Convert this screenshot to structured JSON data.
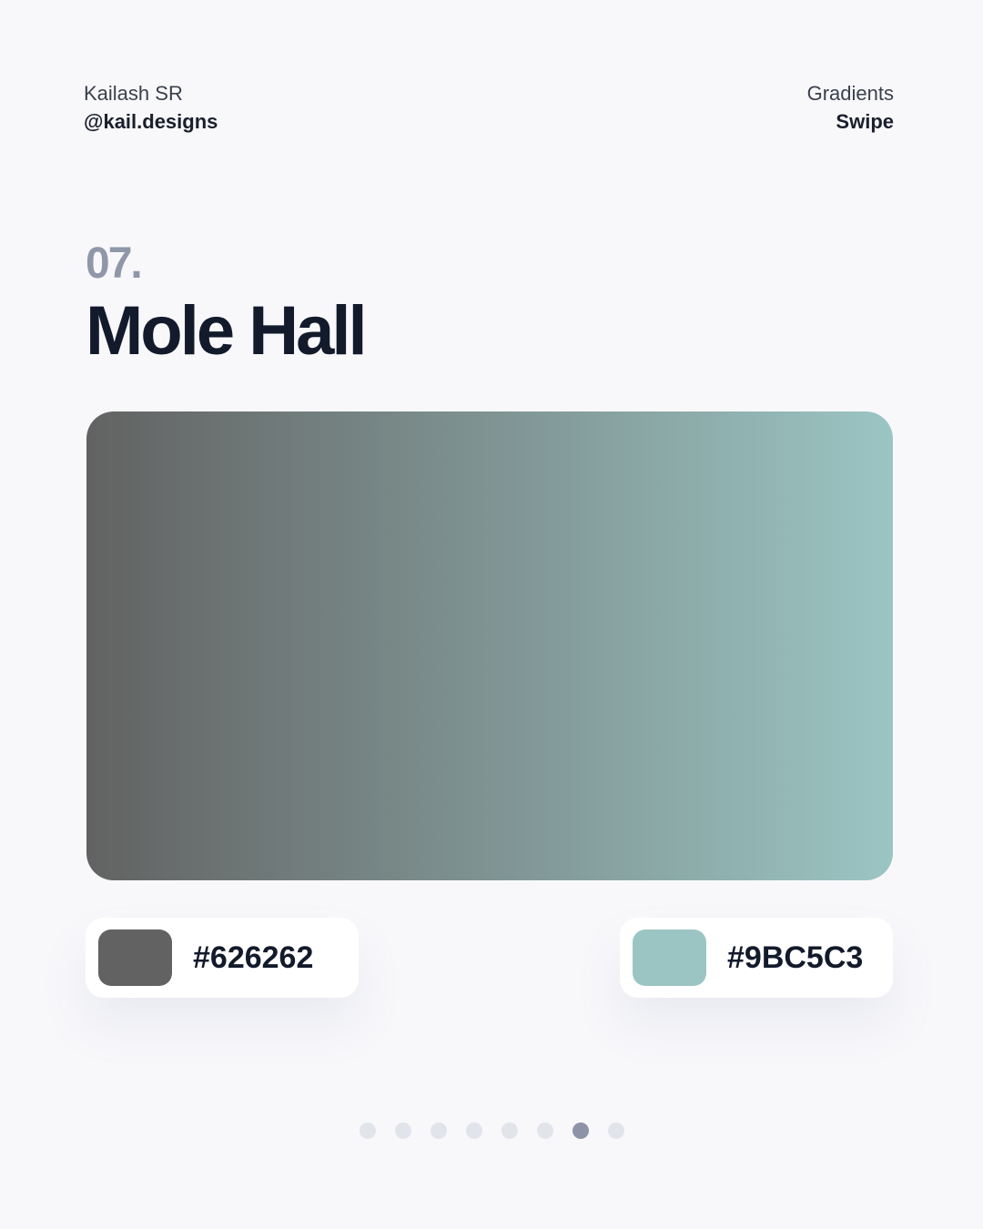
{
  "header": {
    "author_name": "Kailash SR",
    "handle": "@kail.designs",
    "category": "Gradients",
    "action": "Swipe"
  },
  "gradient": {
    "number": "07.",
    "name": "Mole Hall",
    "start_color": "#626262",
    "end_color": "#9BC5C3"
  },
  "swatches": [
    {
      "hex_label": "#626262",
      "color": "#626262"
    },
    {
      "hex_label": "#9BC5C3",
      "color": "#9BC5C3"
    }
  ],
  "pagination": {
    "total": 8,
    "current": 7
  }
}
